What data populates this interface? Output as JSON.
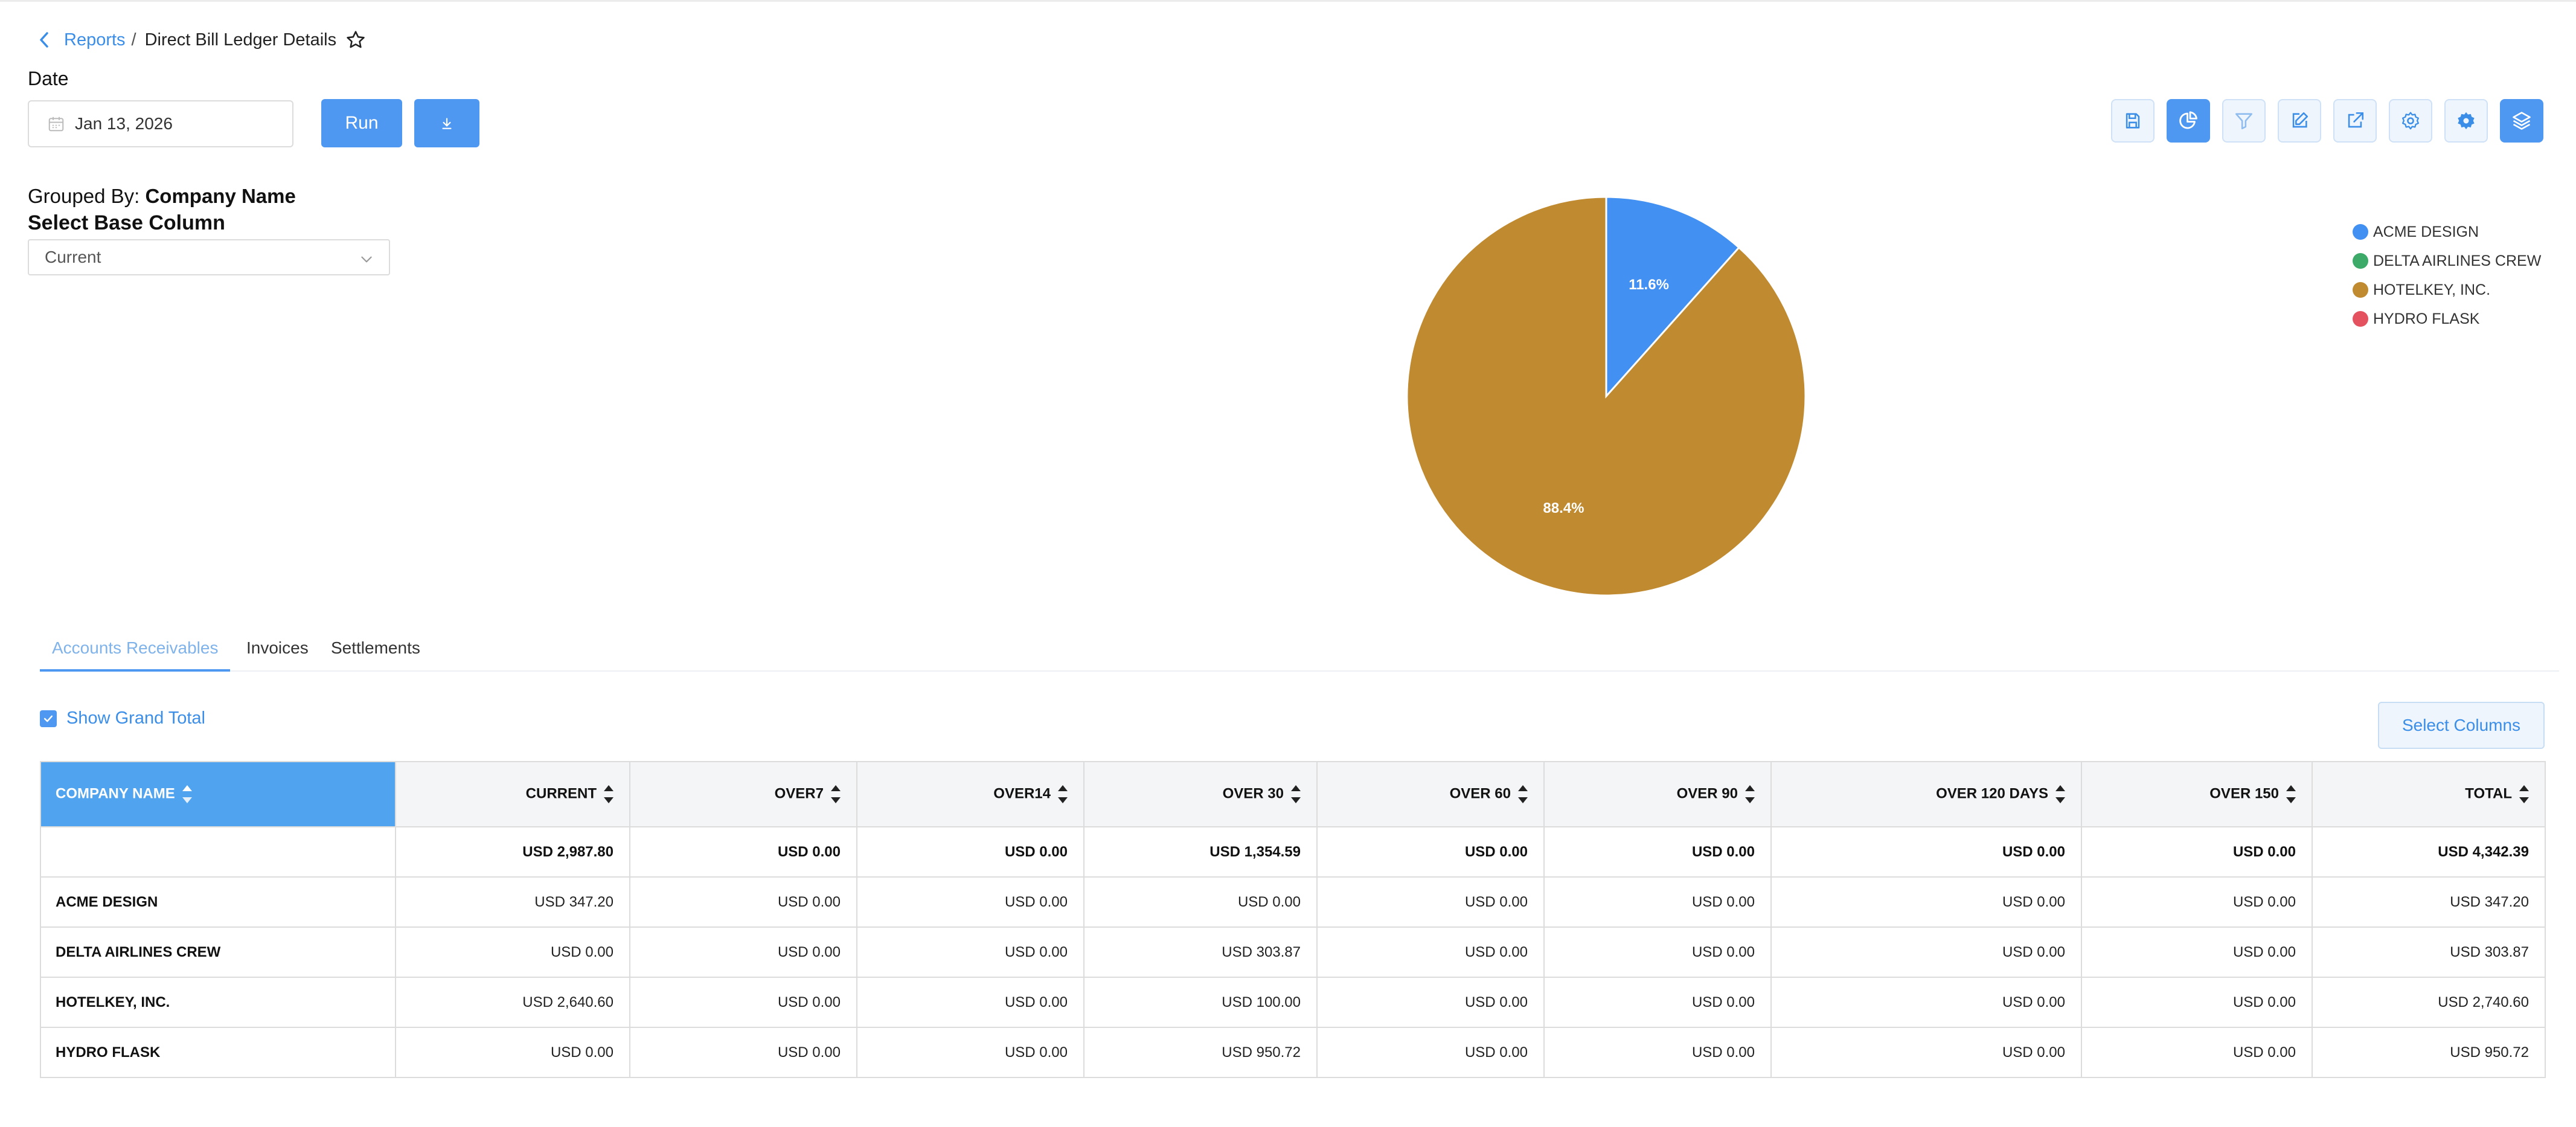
{
  "breadcrumb": {
    "parent": "Reports",
    "separator": "/",
    "current": "Direct Bill Ledger Details"
  },
  "filters": {
    "date_label": "Date",
    "date_value": "Jan 13, 2026",
    "run_label": "Run"
  },
  "toolbar": {
    "icons": [
      "save-icon",
      "pie-chart-icon",
      "filter-icon",
      "edit-icon",
      "export-icon",
      "settings-icon",
      "advanced-settings-icon",
      "layers-icon"
    ],
    "active": [
      "pie-chart-icon",
      "layers-icon"
    ]
  },
  "grouping": {
    "grouped_by_label": "Grouped By:",
    "grouped_by_value": "Company Name",
    "base_column_label": "Select Base Column",
    "base_column_value": "Current"
  },
  "chart_data": {
    "type": "pie",
    "title": "",
    "slices": [
      {
        "label": "ACME DESIGN",
        "value": 11.6,
        "color": "#4190f2"
      },
      {
        "label": "DELTA AIRLINES CREW",
        "value": 0,
        "color": "#3daa6a"
      },
      {
        "label": "HOTELKEY, INC.",
        "value": 88.4,
        "color": "#c08a30"
      },
      {
        "label": "HYDRO FLASK",
        "value": 0,
        "color": "#e4525f"
      }
    ],
    "slice_labels": [
      "11.6%",
      "88.4%"
    ],
    "legend_position": "top-right"
  },
  "tabs": [
    {
      "label": "Accounts Receivables",
      "active": true
    },
    {
      "label": "Invoices",
      "active": false
    },
    {
      "label": "Settlements",
      "active": false
    }
  ],
  "table_controls": {
    "show_grand_total_label": "Show Grand Total",
    "show_grand_total_checked": true,
    "select_columns_label": "Select Columns"
  },
  "table": {
    "headers": [
      "COMPANY NAME",
      "CURRENT",
      "OVER7",
      "OVER14",
      "OVER 30",
      "OVER 60",
      "OVER 90",
      "OVER 120 DAYS",
      "OVER 150",
      "TOTAL"
    ],
    "grand_total": [
      "",
      "USD 2,987.80",
      "USD 0.00",
      "USD 0.00",
      "USD 1,354.59",
      "USD 0.00",
      "USD 0.00",
      "USD 0.00",
      "USD 0.00",
      "USD 4,342.39"
    ],
    "rows": [
      [
        "ACME DESIGN",
        "USD 347.20",
        "USD 0.00",
        "USD 0.00",
        "USD 0.00",
        "USD 0.00",
        "USD 0.00",
        "USD 0.00",
        "USD 0.00",
        "USD 347.20"
      ],
      [
        "DELTA AIRLINES CREW",
        "USD 0.00",
        "USD 0.00",
        "USD 0.00",
        "USD 303.87",
        "USD 0.00",
        "USD 0.00",
        "USD 0.00",
        "USD 0.00",
        "USD 303.87"
      ],
      [
        "HOTELKEY, INC.",
        "USD 2,640.60",
        "USD 0.00",
        "USD 0.00",
        "USD 100.00",
        "USD 0.00",
        "USD 0.00",
        "USD 0.00",
        "USD 0.00",
        "USD 2,740.60"
      ],
      [
        "HYDRO FLASK",
        "USD 0.00",
        "USD 0.00",
        "USD 0.00",
        "USD 950.72",
        "USD 0.00",
        "USD 0.00",
        "USD 0.00",
        "USD 0.00",
        "USD 950.72"
      ]
    ]
  }
}
